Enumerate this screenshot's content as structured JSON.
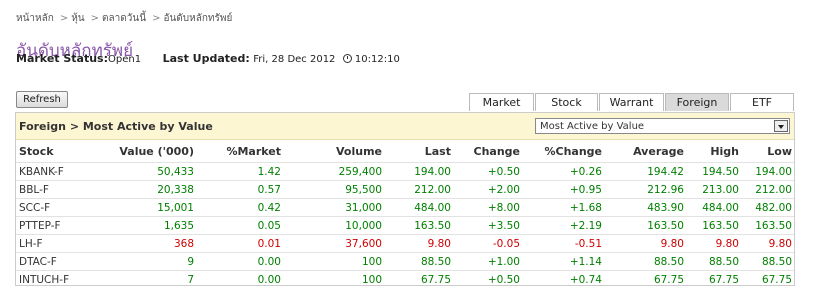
{
  "breadcrumb": [
    "หน้าหลัก",
    "หุ้น",
    "ตลาดวันนี้",
    "อันดับหลักทรัพย์"
  ],
  "breadcrumb_sep": ">",
  "page_title": "อันดับหลักทรัพย์",
  "status": {
    "market_status_label": "Market Status:",
    "market_status_value": "Open1",
    "last_updated_label": "Last Updated:",
    "last_updated_value": "Fri, 28 Dec 2012",
    "time": "10:12:10"
  },
  "refresh_label": "Refresh",
  "tabs": [
    {
      "label": "Market",
      "active": false
    },
    {
      "label": "Stock",
      "active": false
    },
    {
      "label": "Warrant",
      "active": false
    },
    {
      "label": "Foreign",
      "active": true
    },
    {
      "label": "ETF",
      "active": false
    }
  ],
  "panel_title": "Foreign > Most Active by Value",
  "select_value": "Most Active by Value",
  "table": {
    "headers": [
      "Stock",
      "Value ('000)",
      "%Market",
      "Volume",
      "Last",
      "Change",
      "%Change",
      "Average",
      "High",
      "Low"
    ],
    "rows": [
      {
        "trend": "up",
        "cells": [
          "KBANK-F",
          "50,433",
          "1.42",
          "259,400",
          "194.00",
          "+0.50",
          "+0.26",
          "194.42",
          "194.50",
          "194.00"
        ]
      },
      {
        "trend": "up",
        "cells": [
          "BBL-F",
          "20,338",
          "0.57",
          "95,500",
          "212.00",
          "+2.00",
          "+0.95",
          "212.96",
          "213.00",
          "212.00"
        ]
      },
      {
        "trend": "up",
        "cells": [
          "SCC-F",
          "15,001",
          "0.42",
          "31,000",
          "484.00",
          "+8.00",
          "+1.68",
          "483.90",
          "484.00",
          "482.00"
        ]
      },
      {
        "trend": "up",
        "cells": [
          "PTTEP-F",
          "1,635",
          "0.05",
          "10,000",
          "163.50",
          "+3.50",
          "+2.19",
          "163.50",
          "163.50",
          "163.50"
        ]
      },
      {
        "trend": "down",
        "cells": [
          "LH-F",
          "368",
          "0.01",
          "37,600",
          "9.80",
          "-0.05",
          "-0.51",
          "9.80",
          "9.80",
          "9.80"
        ]
      },
      {
        "trend": "up",
        "cells": [
          "DTAC-F",
          "9",
          "0.00",
          "100",
          "88.50",
          "+1.00",
          "+1.14",
          "88.50",
          "88.50",
          "88.50"
        ]
      },
      {
        "trend": "up",
        "cells": [
          "INTUCH-F",
          "7",
          "0.00",
          "100",
          "67.75",
          "+0.50",
          "+0.74",
          "67.75",
          "67.75",
          "67.75"
        ]
      }
    ]
  },
  "colors": {
    "up": "#008000",
    "down": "#d00000",
    "title": "#8a57a8",
    "panel_header_bg": "#fdf6d3"
  }
}
